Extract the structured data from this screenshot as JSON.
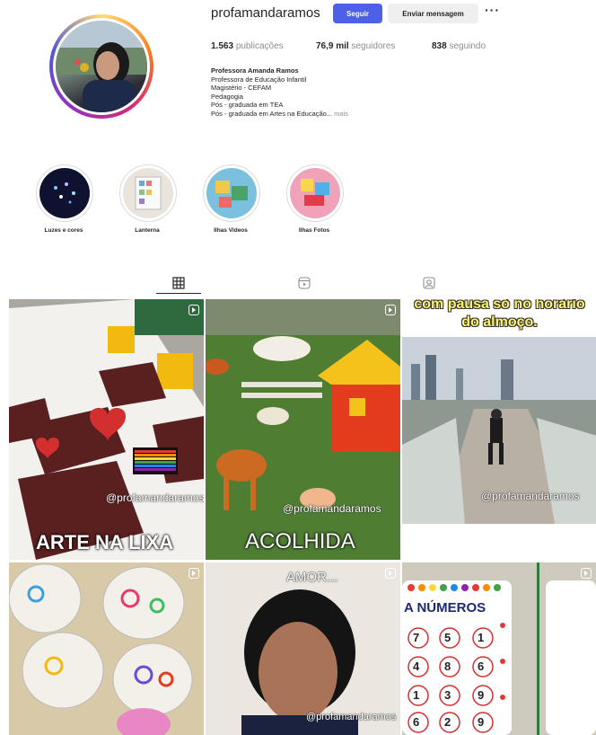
{
  "profile": {
    "username": "profamandaramos",
    "follow_label": "Seguir",
    "message_label": "Enviar mensagem",
    "more_label": "···",
    "posts_count": "1.563",
    "posts_label": "publicações",
    "followers_count": "76,9 mil",
    "followers_label": "seguidores",
    "following_count": "838",
    "following_label": "seguindo"
  },
  "bio": {
    "name": "Professora Amanda Ramos",
    "lines": [
      "Professora de Educação Infantil",
      "Magistério - CEFAM",
      "Pedagogia",
      "Pós - graduada em TEA"
    ],
    "last_line": "Pós - graduada em Artes na Educação...",
    "more": "mais"
  },
  "highlights": [
    {
      "label": "Luzes e cores"
    },
    {
      "label": "Lanterna"
    },
    {
      "label": "Ilhas Videos"
    },
    {
      "label": "Ilhas Fotos"
    }
  ],
  "tabs": [
    {
      "icon": "grid-icon"
    },
    {
      "icon": "reels-icon"
    },
    {
      "icon": "tagged-icon"
    }
  ],
  "posts": [
    {
      "caption": "ARTE NA LIXA",
      "watermark": "@profamandaramos"
    },
    {
      "caption": "ACOLHIDA",
      "watermark": "@profamandaramos"
    },
    {
      "top_text_1": "com pausa só no horário",
      "top_text_2": "do almoço.",
      "watermark": "@profamandaramos"
    },
    {
      "caption": ""
    },
    {
      "top_text": "AMOR...",
      "watermark": "@profamandaramos"
    },
    {
      "top_text": "A NÚMEROS",
      "numbers": [
        "7",
        "5",
        "1",
        "4",
        "8",
        "6",
        "1",
        "3",
        "9",
        "6",
        "2",
        "9"
      ]
    }
  ],
  "colors": {
    "accent": "#4c60e8",
    "secondary_button": "#efefef",
    "muted_text": "#8e8e8e"
  }
}
